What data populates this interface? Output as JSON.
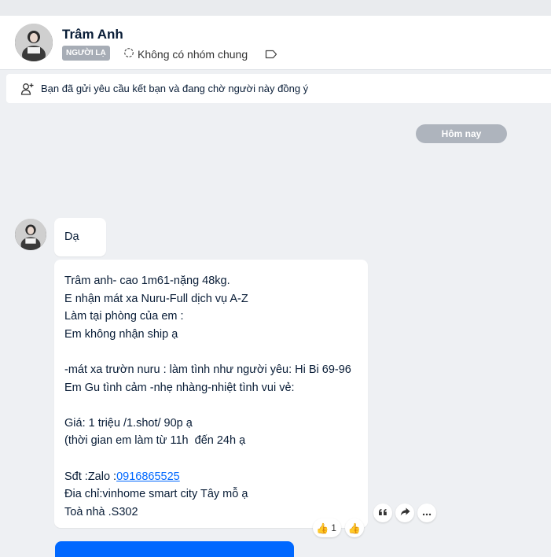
{
  "contact": {
    "name": "Trâm Anh",
    "badge": "NGƯỜI LẠ",
    "group_info": "Không có nhóm chung"
  },
  "notice": {
    "text": "Bạn đã gửi yêu cầu kết bạn và đang chờ người này đồng ý"
  },
  "date_label": "Hôm nay",
  "messages": [
    {
      "text": "Dạ"
    },
    {
      "lines": [
        "Trâm anh- cao 1m61-nặng 48kg.",
        "E nhận mát xa Nuru-Full dịch vụ A-Z",
        "Làm tại phòng của em :",
        "Em không nhận ship ạ",
        "",
        "-mát xa trườn nuru : làm tình như người yêu: Hi Bi 69-96",
        "Em Gu tình cảm -nhẹ nhàng-nhiệt tình vui vẻ:",
        "",
        "Giá: 1 triệu /1.shot/ 90p ạ",
        "(thời gian em làm từ 11h  đến 24h ạ",
        "",
        "Sđt :Zalo :",
        "Đia chỉ:vinhome smart city Tây mỗ ạ",
        "Toà nhà .S302"
      ],
      "phone": "0916865525",
      "reaction_count": "1"
    }
  ],
  "icons": {
    "group": "group-circle-icon",
    "tag": "tag-icon",
    "add_friend": "add-friend-icon",
    "quote": "quote-icon",
    "share": "share-icon",
    "more": "more-icon",
    "reaction": "thumbs-up-icon"
  },
  "colors": {
    "accent": "#0068ff",
    "badge_bg": "#a7adb6",
    "background": "#eef0f3"
  }
}
